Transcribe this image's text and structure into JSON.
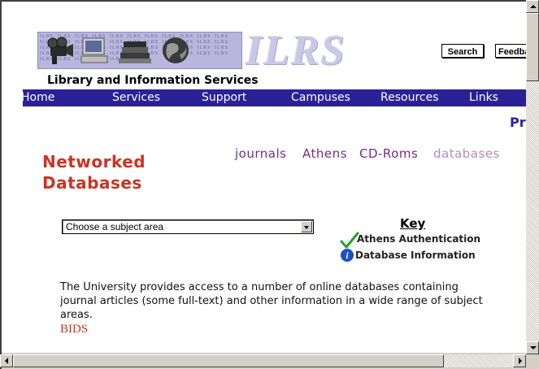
{
  "banner": {
    "pattern_text": "ILRS ILRS ILRS ILRS ILRS ILRS ILRS ILRS ILRS ILRS ILRS ILRS ILRS ILRS ILRS ILRS ILRS ILRS ILRS ILRS ILRS ILRS ILRS ILRS ILRS ILRS ILRS ILRS ILRS ILRS ILRS ILRS ILRS ILRS ILRS ILRS ILRS ILRS ILRS ILRS ILRS ILRS ILRS ILRS ILRS ILRS ILRS ILRS ILRS ILRS",
    "logo_text": "ILRS"
  },
  "header": {
    "search_label": "Search",
    "feedback_label": "Feedback",
    "service_title": "Library and Information Services"
  },
  "nav": {
    "items": [
      {
        "label": "Home"
      },
      {
        "label": "Services"
      },
      {
        "label": "Support"
      },
      {
        "label": "Campuses"
      },
      {
        "label": "Resources"
      },
      {
        "label": "Links"
      }
    ]
  },
  "partial_right_text": "Pre",
  "subnav": {
    "journals": "journals",
    "athens": "Athens",
    "cdroms": "CD-Roms",
    "databases": "databases"
  },
  "colors": {
    "nav_bg": "#2b2196",
    "title_red": "#cc3322",
    "subnav_purple": "#7a2a8e",
    "subnav_current": "#b58ac6"
  },
  "page_title": {
    "line1": "Networked",
    "line2": "Databases"
  },
  "subject_select": {
    "selected": "Choose a subject area"
  },
  "key": {
    "heading": "Key",
    "athens_auth": "Athens Authentication",
    "db_info": "Database Information",
    "athens_icon": "checkmark-icon",
    "info_icon": "info-icon"
  },
  "content": {
    "description": "The University provides access to a number of online databases containing journal articles (some full-text) and other information in a wide range of subject areas.",
    "bids_link": "BIDS"
  }
}
